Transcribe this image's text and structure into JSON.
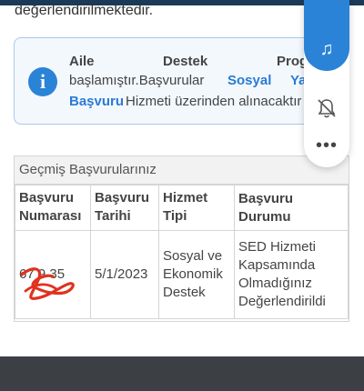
{
  "page": {
    "intro_fragment": "değerlendirilmektedir."
  },
  "info_box": {
    "line1": [
      "Aile",
      "Destek",
      "Prog"
    ],
    "line2_a": "başlamıştır.Başvurular",
    "line2_link1": "Sosyal",
    "line2_link2": "Yardım",
    "line3_link": "Başvuru",
    "line3_rest": "Hizmeti üzerinden alınacaktır"
  },
  "floating_panel": {
    "music_icon": "music-note-icon",
    "mute_icon": "bell-off-icon",
    "more_icon": "more-dots-icon",
    "more_glyph": "•••"
  },
  "history": {
    "title": "Geçmiş Başvurularınız",
    "columns": [
      "Başvuru Numarası",
      "Başvuru Tarihi",
      "Hizmet Tipi",
      "Başvuru Durumu"
    ],
    "rows": [
      {
        "number": "67 9 35",
        "date": "5/1/2023",
        "service": "Sosyal ve Ekonomik Destek",
        "status": "SED Hizmeti Kapsamında Olmadığınız Değerlendirildi"
      }
    ]
  },
  "colors": {
    "accent": "#2a83d6",
    "footer": "#3c3f44",
    "redaction": "#e0321e"
  }
}
